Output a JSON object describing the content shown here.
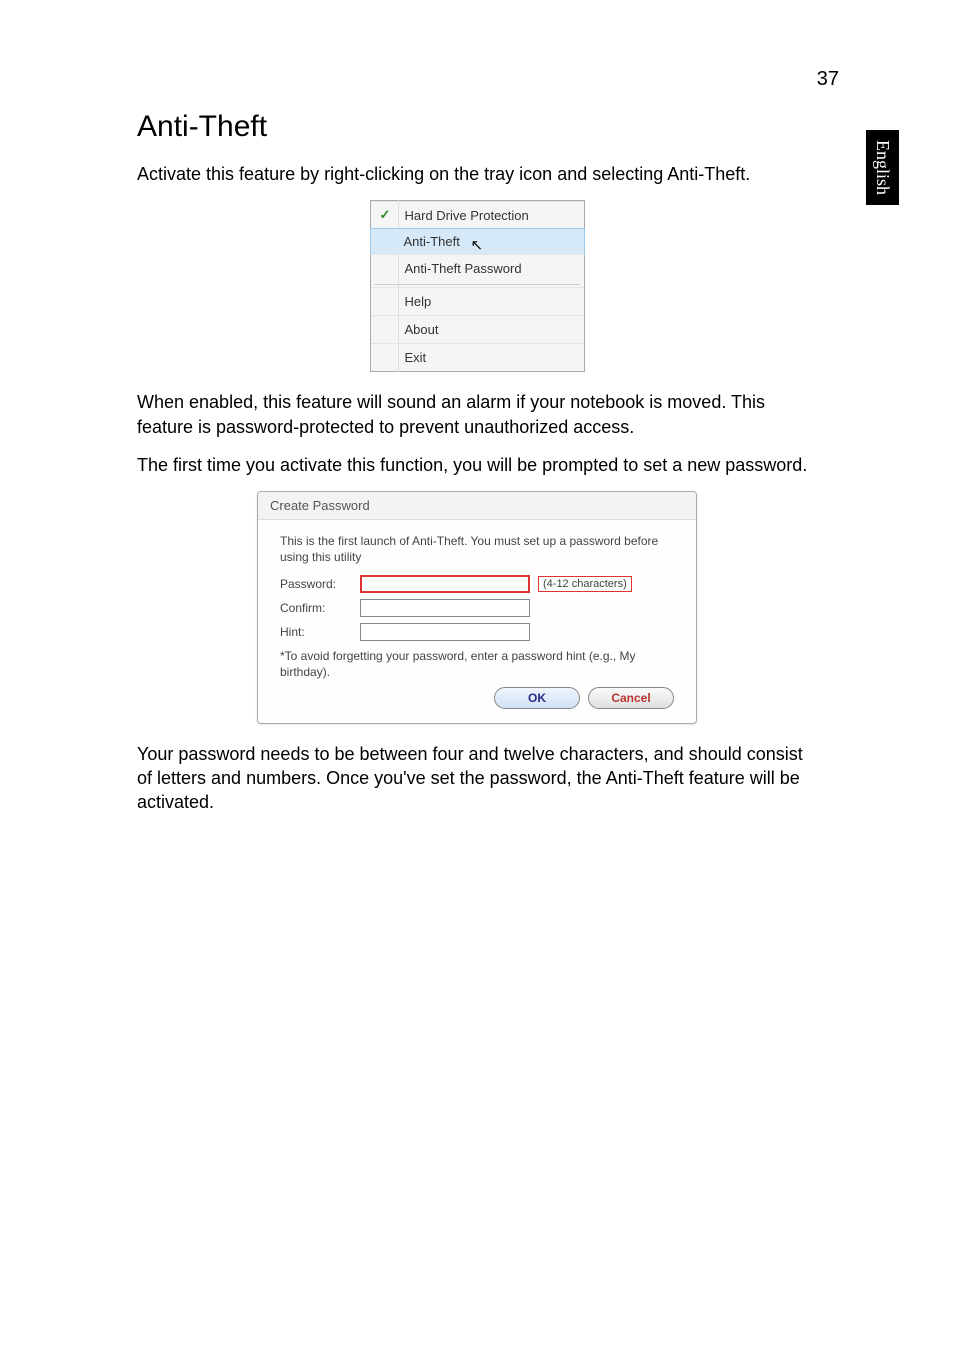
{
  "page_number": "37",
  "side_tab": "English",
  "heading": "Anti-Theft",
  "para1": "Activate this feature by right-clicking on the tray icon and selecting Anti-Theft.",
  "context_menu": {
    "items": [
      {
        "label": "Hard Drive Protection",
        "checked": true
      },
      {
        "label": "Anti-Theft",
        "highlighted": true
      },
      {
        "label": "Anti-Theft Password"
      },
      {
        "label": "Help"
      },
      {
        "label": "About"
      },
      {
        "label": "Exit"
      }
    ]
  },
  "para2": "When enabled, this feature will sound an alarm if your notebook is moved. This feature is password-protected to prevent unauthorized access.",
  "para3": "The first time you activate this function, you will be prompted to set a new password.",
  "dialog": {
    "title": "Create Password",
    "intro": "This is the first launch of Anti-Theft. You must set up a password before using this utility",
    "password_label": "Password:",
    "password_range": "(4-12 characters)",
    "confirm_label": "Confirm:",
    "hint_label": "Hint:",
    "hint_note": "*To avoid forgetting your password, enter a password hint (e.g., My birthday).",
    "ok": "OK",
    "cancel": "Cancel"
  },
  "para4": "Your password needs to be between four and twelve characters, and should consist of letters and numbers. Once you've set the password, the Anti-Theft feature will be activated."
}
